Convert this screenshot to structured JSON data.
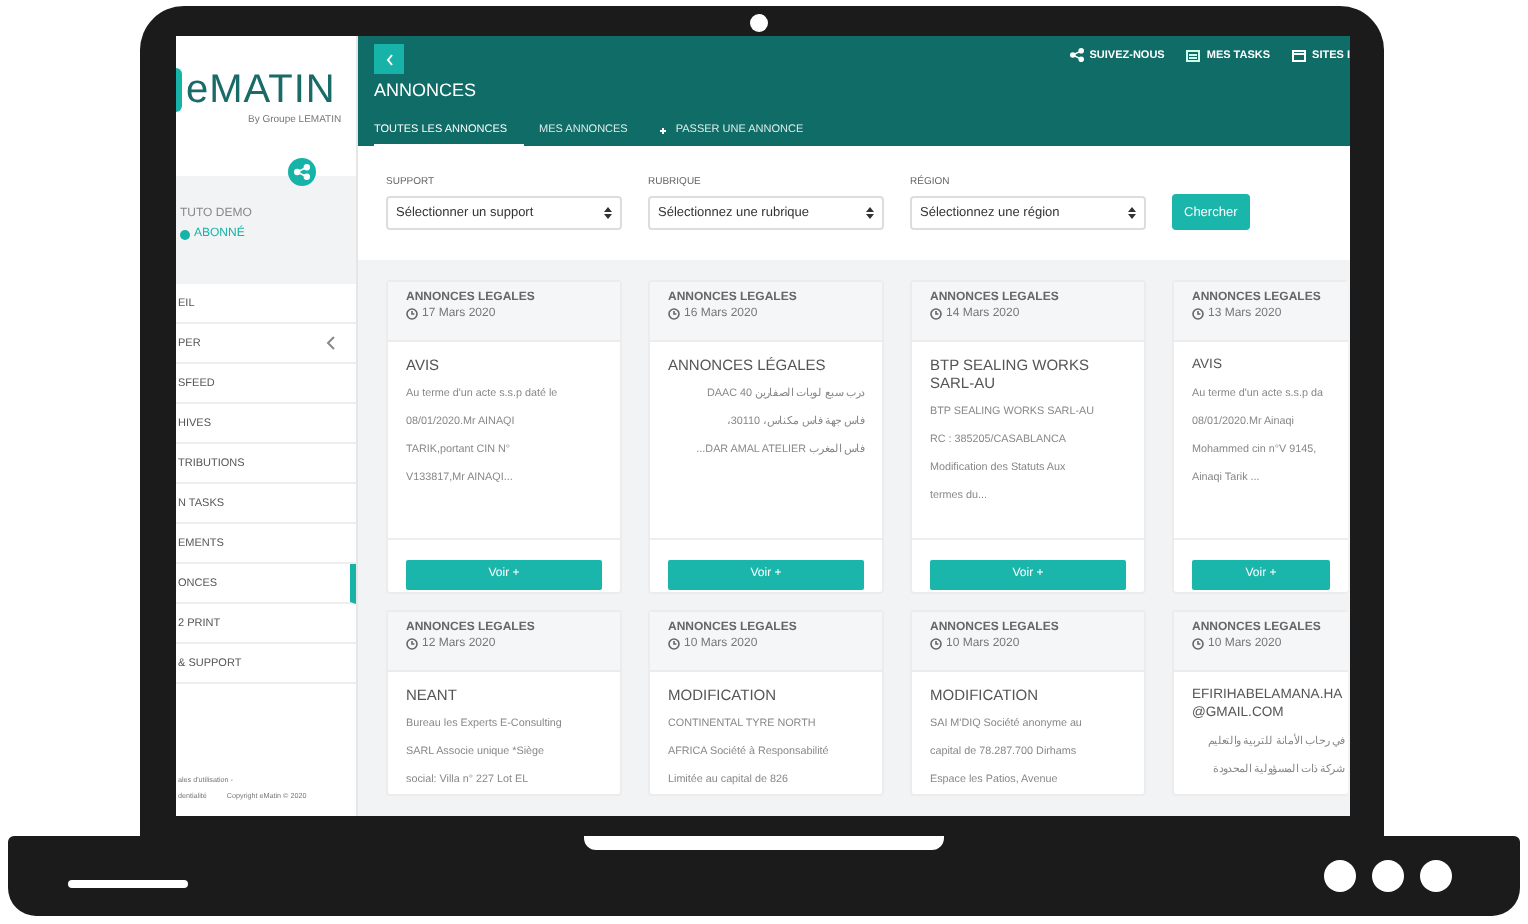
{
  "sidebar": {
    "logo": "eMATIN",
    "logo_subtitle": "By Groupe LEMATIN",
    "user": {
      "name": "TUTO DEMO",
      "status": "ABONNÉ"
    },
    "items": [
      {
        "label": "EIL",
        "selected": false,
        "has_submenu": false
      },
      {
        "label": "PER",
        "selected": false,
        "has_submenu": true
      },
      {
        "label": "SFEED",
        "selected": false,
        "has_submenu": false
      },
      {
        "label": "HIVES",
        "selected": false,
        "has_submenu": false
      },
      {
        "label": "TRIBUTIONS",
        "selected": false,
        "has_submenu": false
      },
      {
        "label": "N TASKS",
        "selected": false,
        "has_submenu": false
      },
      {
        "label": "EMENTS",
        "selected": false,
        "has_submenu": false
      },
      {
        "label": "ONCES",
        "selected": true,
        "has_submenu": false
      },
      {
        "label": "2 PRINT",
        "selected": false,
        "has_submenu": false
      },
      {
        "label": "& SUPPORT",
        "selected": false,
        "has_submenu": false
      }
    ],
    "footer": {
      "line_1": "ales d'utilisation -",
      "line_2": "dentialité",
      "copyright": "Copyright eMatin © 2020"
    }
  },
  "topbar": {
    "links": [
      {
        "kind": "share",
        "label": "SUIVEZ-NOUS"
      },
      {
        "kind": "tasks",
        "label": "MES TASKS"
      },
      {
        "kind": "sites",
        "label": "SITES I"
      }
    ],
    "title": "ANNONCES",
    "tabs": [
      {
        "label": "TOUTES LES ANNONCES",
        "selected": true,
        "kind": "link"
      },
      {
        "label": "MES ANNONCES",
        "selected": false,
        "kind": "link"
      },
      {
        "label": "PASSER UNE ANNONCE",
        "selected": false,
        "kind": "add"
      }
    ]
  },
  "filters": [
    {
      "label": "SUPPORT",
      "placeholder": "Sélectionner un support"
    },
    {
      "label": "RUBRIQUE",
      "placeholder": "Sélectionnez une rubrique"
    },
    {
      "label": "RÉGION",
      "placeholder": "Sélectionnez une région"
    }
  ],
  "search_button": "Chercher",
  "cards": [
    {
      "category": "ANNONCES LEGALES",
      "date": "17 Mars 2020",
      "title": "AVIS",
      "lines": [
        "Au terme d'un acte s.s.p daté le",
        "08/01/2020.Mr AINAQI",
        "TARIK,portant CIN N°",
        "V133817,Mr AINAQI..."
      ],
      "button": "Voir +"
    },
    {
      "category": "ANNONCES LEGALES",
      "date": "16 Mars 2020",
      "title": "ANNONCES LÉGALES",
      "lines": [
        "درب سبع لويات الصفارين DAAC 40",
        "فاس جهة فاس مكناس، 30110،",
        "فاس المغرب DAR AMAL ATELIER..."
      ],
      "button": "Voir +"
    },
    {
      "category": "ANNONCES LEGALES",
      "date": "14 Mars 2020",
      "title": "BTP SEALING WORKS SARL-AU",
      "lines": [
        "BTP SEALING WORKS SARL-AU",
        "RC : 385205/CASABLANCA",
        "Modification des Statuts Aux",
        "termes du..."
      ],
      "button": "Voir +"
    },
    {
      "category": "ANNONCES LEGALES",
      "date": "13 Mars 2020",
      "title": "AVIS",
      "lines": [
        "Au terme d'un acte s.s.p da",
        "08/01/2020.Mr Ainaqi",
        "Mohammed cin n°V 9145,",
        "Ainaqi Tarik ..."
      ],
      "button": "Voir +"
    },
    {
      "category": "ANNONCES LEGALES",
      "date": "12 Mars 2020",
      "title": "NEANT",
      "lines": [
        "Bureau les Experts E-Consulting",
        "SARL Associe unique *Siège",
        "social: Villa n° 227 Lot EL"
      ]
    },
    {
      "category": "ANNONCES LEGALES",
      "date": "10 Mars 2020",
      "title": "MODIFICATION",
      "lines": [
        "CONTINENTAL TYRE NORTH",
        "AFRICA Société à Responsabilité",
        "Limitée au capital de 826"
      ]
    },
    {
      "category": "ANNONCES LEGALES",
      "date": "10 Mars 2020",
      "title": "MODIFICATION",
      "lines": [
        "SAI M'DIQ Société anonyme au",
        "capital de 78.287.700 Dirhams",
        "Espace les Patios, Avenue"
      ]
    },
    {
      "category": "ANNONCES LEGALES",
      "date": "10 Mars 2020",
      "title": "EFIRIHABELAMANA.HA @GMAIL.COM",
      "lines": [
        "في رحاب الأمانة للتربية والتعليم",
        "شركة ذات المسؤولية المحدودة"
      ]
    }
  ]
}
